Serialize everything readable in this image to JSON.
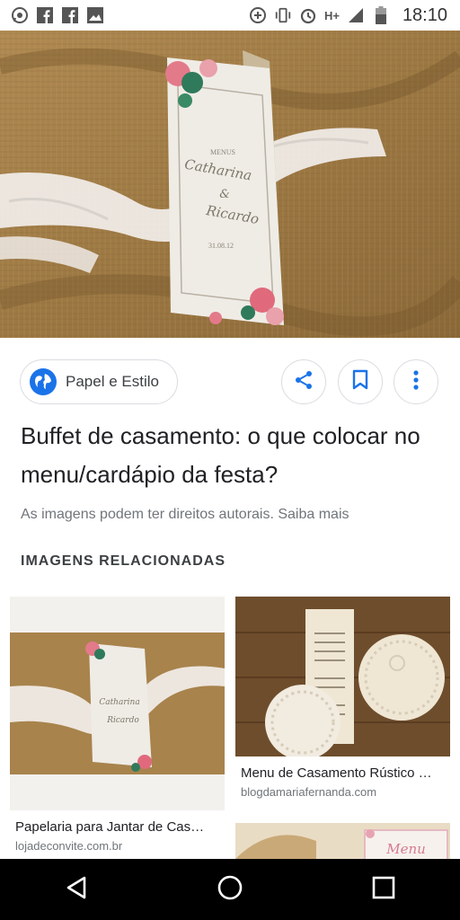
{
  "status_bar": {
    "time": "18:10",
    "network": "H+",
    "left_icons": [
      "whatsapp-icon",
      "facebook-icon",
      "facebook-icon",
      "gallery-icon"
    ],
    "right_icons": [
      "data-saver-icon",
      "vibrate-icon",
      "alarm-icon",
      "signal-icon",
      "battery-icon"
    ]
  },
  "hero": {
    "menu_card": {
      "heading": "MENUS",
      "line1": "Catharina",
      "line2": "&",
      "line3": "Ricardo",
      "date": "31.08.12"
    }
  },
  "source": {
    "name": "Papel e Estilo"
  },
  "actions": {
    "share": "share-icon",
    "save": "bookmark-icon",
    "more": "more-vert-icon"
  },
  "result": {
    "title": "Buffet de casamento: o que colocar no menu/cardápio da festa?",
    "copyright": "As imagens podem ter direitos autorais. Saiba mais"
  },
  "related": {
    "heading": "IMAGENS RELACIONADAS",
    "items": [
      {
        "title": "Papelaria para Jantar de Cas…",
        "source": "lojadeconvite.com.br"
      },
      {
        "title": "Menu de Casamento Rústico …",
        "source": "blogdamariafernanda.com"
      },
      {
        "title": "",
        "source": "",
        "partial_text": "Menu"
      }
    ]
  },
  "navbar": {
    "back": "back-icon",
    "home": "home-icon",
    "recents": "recents-icon"
  },
  "colors": {
    "accent": "#1a73e8",
    "burlap": "#a8834c",
    "text": "#202124",
    "muted": "#70757a"
  }
}
